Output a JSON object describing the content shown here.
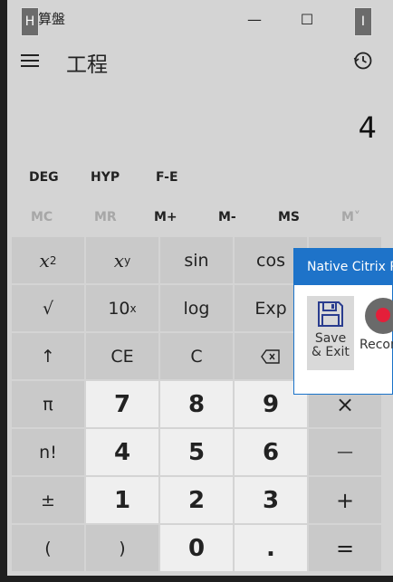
{
  "window": {
    "title": "算盤",
    "controls": {
      "minimize": "—",
      "maximize": "☐",
      "close": "✕"
    }
  },
  "markers": {
    "left": "H",
    "right": "I"
  },
  "header": {
    "mode_title": "工程"
  },
  "display": {
    "value": "4"
  },
  "mode_row": [
    "DEG",
    "HYP",
    "F-E"
  ],
  "memory": [
    "MC",
    "MR",
    "M+",
    "M-",
    "MS",
    "M˅"
  ],
  "keys": {
    "x2": "2",
    "xy": "y",
    "sin": "sin",
    "cos": "cos",
    "sqrt": "√",
    "ten_x": "10",
    "ten_x_sup": "x",
    "log": "log",
    "exp": "Exp",
    "shift": "↑",
    "ce": "CE",
    "c": "C",
    "pi": "π",
    "seven": "7",
    "eight": "8",
    "nine": "9",
    "multiply": "×",
    "fact": "n!",
    "four": "4",
    "five": "5",
    "six": "6",
    "minus": "—",
    "negate": "±",
    "one": "1",
    "two": "2",
    "three": "3",
    "plus": "+",
    "lparen": "(",
    "rparen": ")",
    "zero": "0",
    "decimal": ".",
    "equals": "="
  },
  "popup": {
    "title": "Native Citrix R",
    "save_line1": "Save",
    "save_line2": "& Exit",
    "record_label": "Recor"
  }
}
